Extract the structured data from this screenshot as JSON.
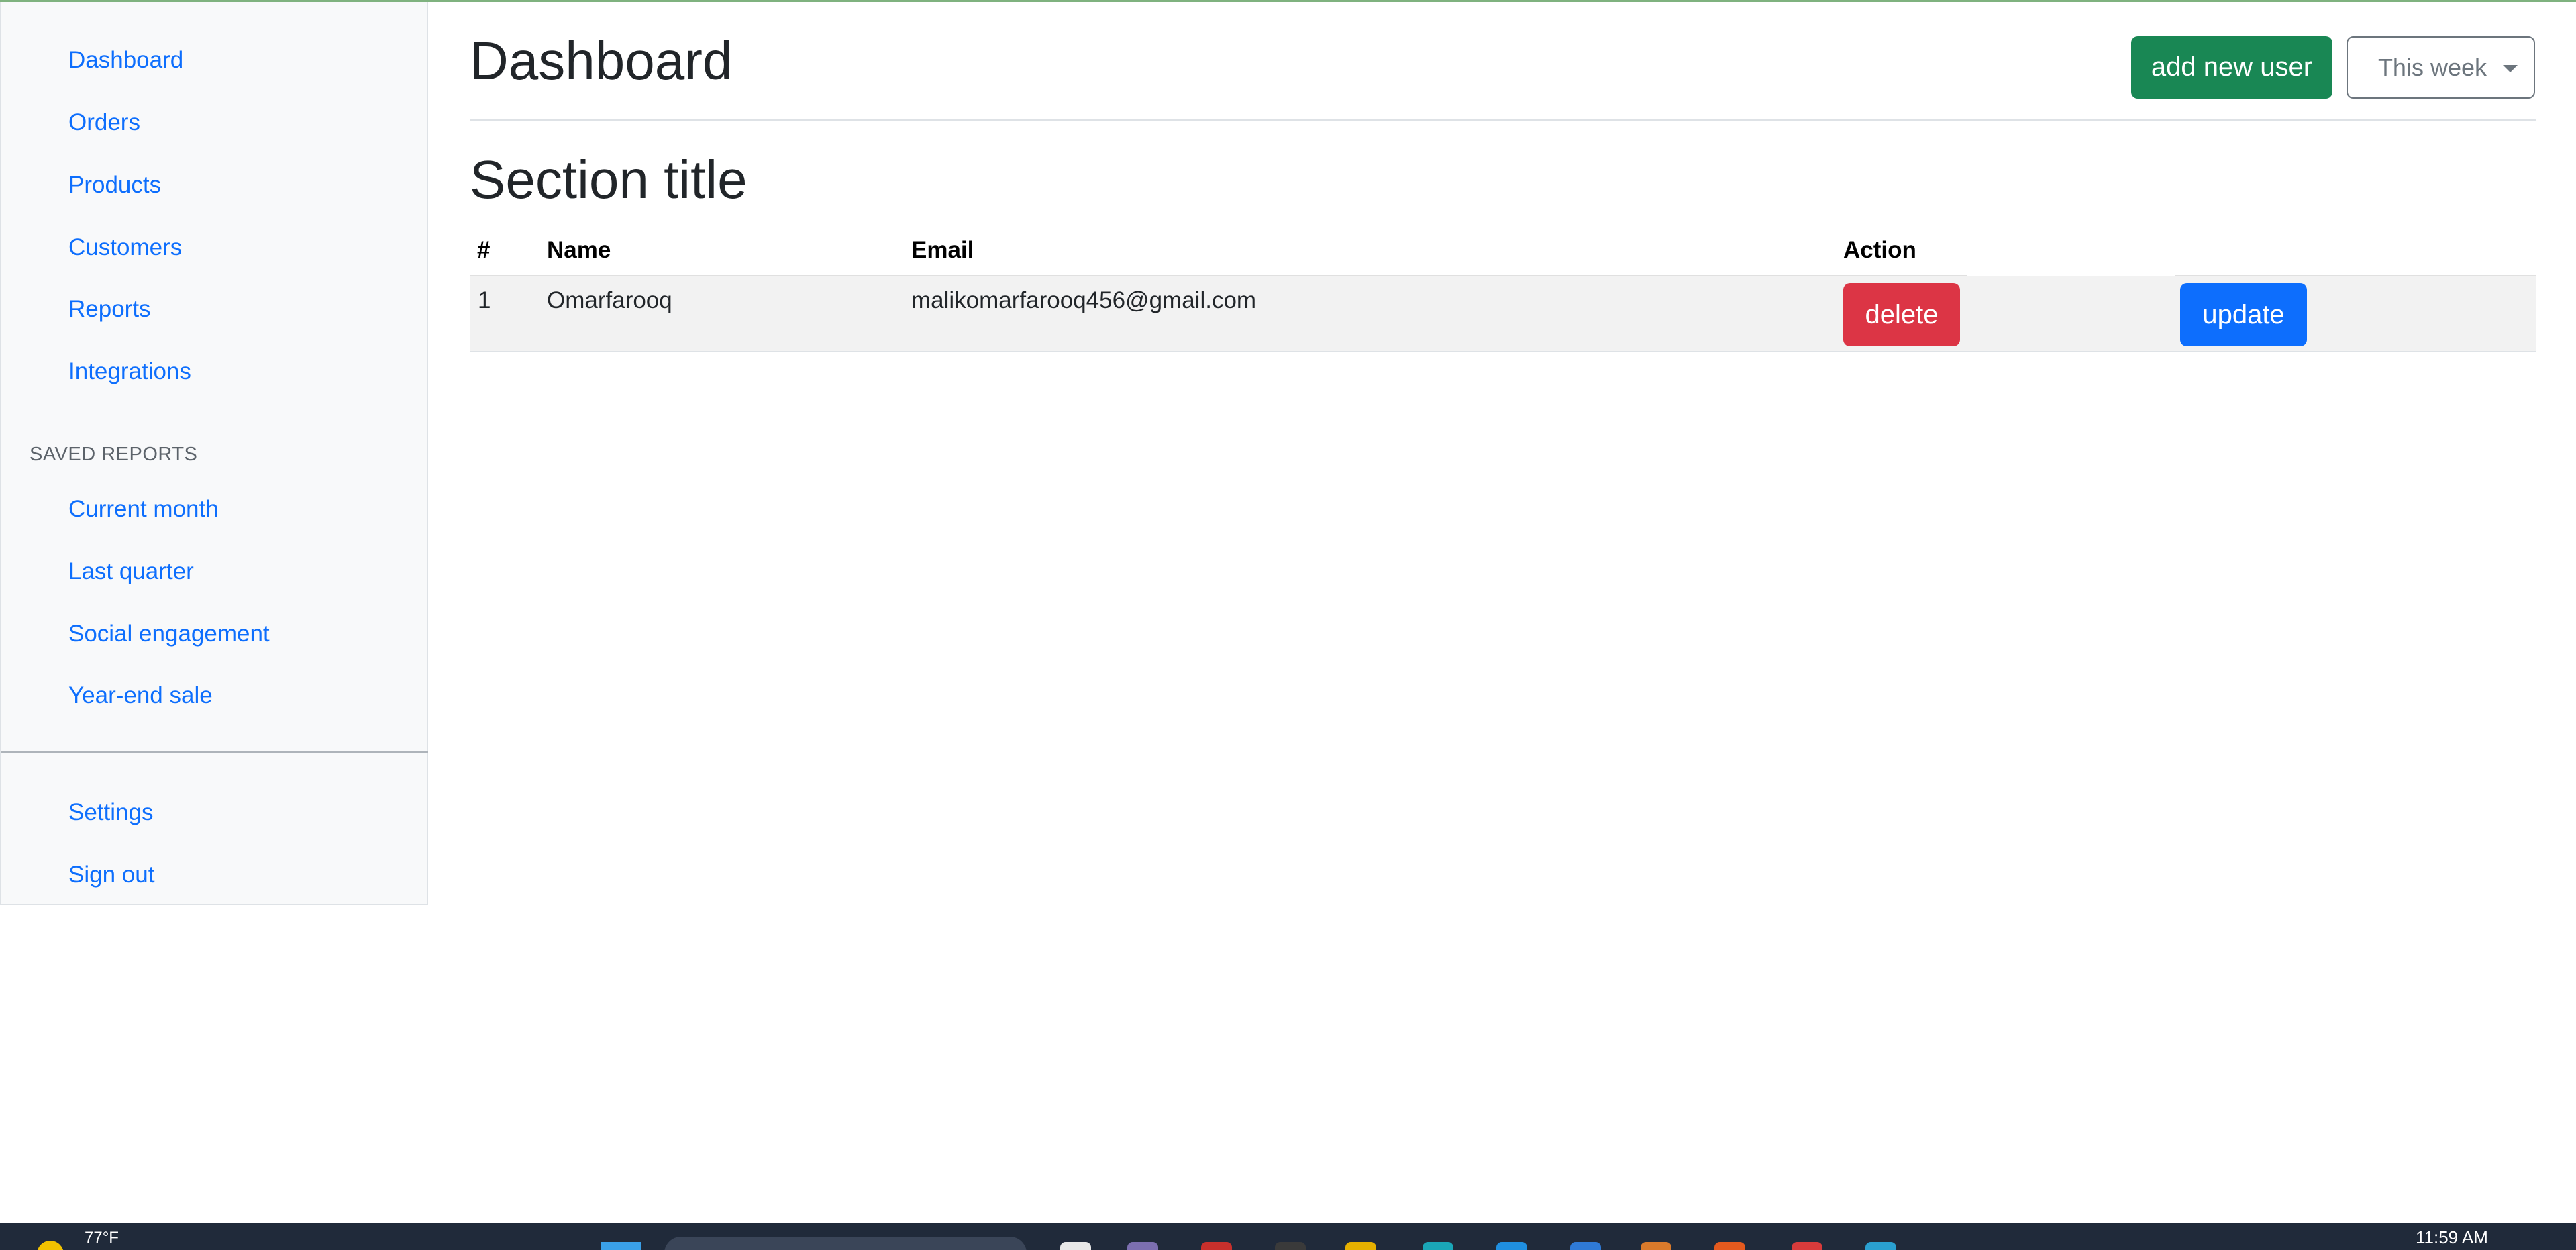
{
  "sidebar": {
    "nav_items": [
      {
        "label": "Dashboard"
      },
      {
        "label": "Orders"
      },
      {
        "label": "Products"
      },
      {
        "label": "Customers"
      },
      {
        "label": "Reports"
      },
      {
        "label": "Integrations"
      }
    ],
    "saved_reports_heading": "SAVED REPORTS",
    "saved_reports": [
      {
        "label": "Current month"
      },
      {
        "label": "Last quarter"
      },
      {
        "label": "Social engagement"
      },
      {
        "label": "Year-end sale"
      }
    ],
    "footer_items": [
      {
        "label": "Settings"
      },
      {
        "label": "Sign out"
      }
    ]
  },
  "header": {
    "title": "Dashboard",
    "add_user_label": "add new user",
    "period_label": "This week"
  },
  "section": {
    "title": "Section title"
  },
  "table": {
    "columns": [
      "#",
      "Name",
      "Email",
      "Action"
    ],
    "rows": [
      {
        "index": "1",
        "name": "Omarfarooq",
        "email": "malikomarfarooq456@gmail.com",
        "delete_label": "delete",
        "update_label": "update"
      }
    ]
  },
  "taskbar": {
    "temperature": "77°F",
    "clock": "11:59 AM"
  },
  "colors": {
    "link": "#0d6efd",
    "success": "#198754",
    "danger": "#dc3545",
    "primary": "#0d6efd",
    "sidebar_bg": "#f8f9fa",
    "taskbar_bg": "#202a3a"
  }
}
